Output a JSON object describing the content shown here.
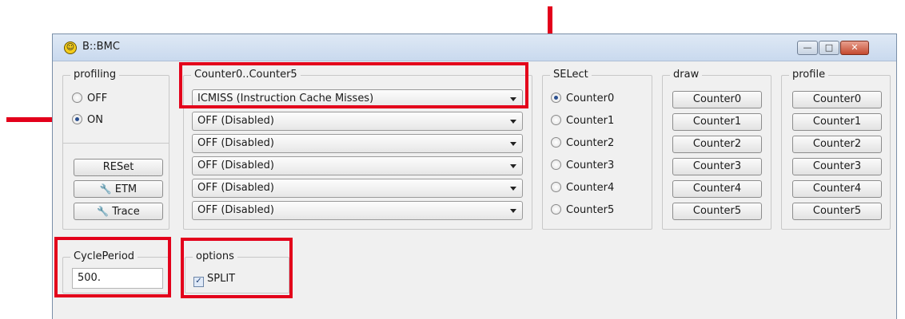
{
  "window": {
    "title": "B::BMC",
    "buttons": {
      "minimize": "—",
      "maximize": "□",
      "close": "✕"
    }
  },
  "profiling": {
    "legend": "profiling",
    "options": [
      {
        "label": "OFF",
        "selected": false
      },
      {
        "label": "ON",
        "selected": true
      }
    ],
    "buttons": {
      "reset": "RESet",
      "etm": "ETM",
      "trace": "Trace"
    }
  },
  "counters": {
    "legend": "Counter0..Counter5",
    "values": [
      "ICMISS (Instruction Cache Misses)",
      "OFF (Disabled)",
      "OFF (Disabled)",
      "OFF (Disabled)",
      "OFF (Disabled)",
      "OFF (Disabled)"
    ]
  },
  "select": {
    "legend": "SELect",
    "items": [
      "Counter0",
      "Counter1",
      "Counter2",
      "Counter3",
      "Counter4",
      "Counter5"
    ],
    "selected": "Counter0"
  },
  "draw": {
    "legend": "draw",
    "buttons": [
      "Counter0",
      "Counter1",
      "Counter2",
      "Counter3",
      "Counter4",
      "Counter5"
    ]
  },
  "profile": {
    "legend": "profile",
    "buttons": [
      "Counter0",
      "Counter1",
      "Counter2",
      "Counter3",
      "Counter4",
      "Counter5"
    ]
  },
  "cycle_period": {
    "legend": "CyclePeriod",
    "value": "500."
  },
  "options": {
    "legend": "options",
    "split_label": "SPLIT",
    "split_checked": true
  },
  "icons": {
    "app": "debugger-app-icon",
    "etm": "wrench-icon",
    "trace": "wrench-icon"
  },
  "colors": {
    "annotation": "#e3001b",
    "window_bg": "#f0f0f0"
  }
}
